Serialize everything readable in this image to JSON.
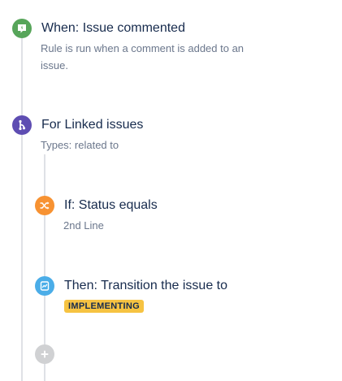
{
  "trigger": {
    "title": "When: Issue commented",
    "description": "Rule is run when a comment is added to an issue.",
    "icon": "comment-trigger-icon",
    "color": "#57A55A"
  },
  "branch": {
    "title": "For Linked issues",
    "description": "Types: related to",
    "icon": "branch-icon",
    "color": "#5E4DB2"
  },
  "condition": {
    "title": "If: Status equals",
    "description": "2nd Line",
    "icon": "shuffle-icon",
    "color": "#F79232"
  },
  "action": {
    "title": "Then: Transition the issue to",
    "status_lozenge": "IMPLEMENTING",
    "icon": "transition-icon",
    "color": "#4BADE8",
    "lozenge_color": "#F6C342"
  },
  "add_component": {
    "icon": "plus-icon",
    "color": "#D0D1D3"
  }
}
